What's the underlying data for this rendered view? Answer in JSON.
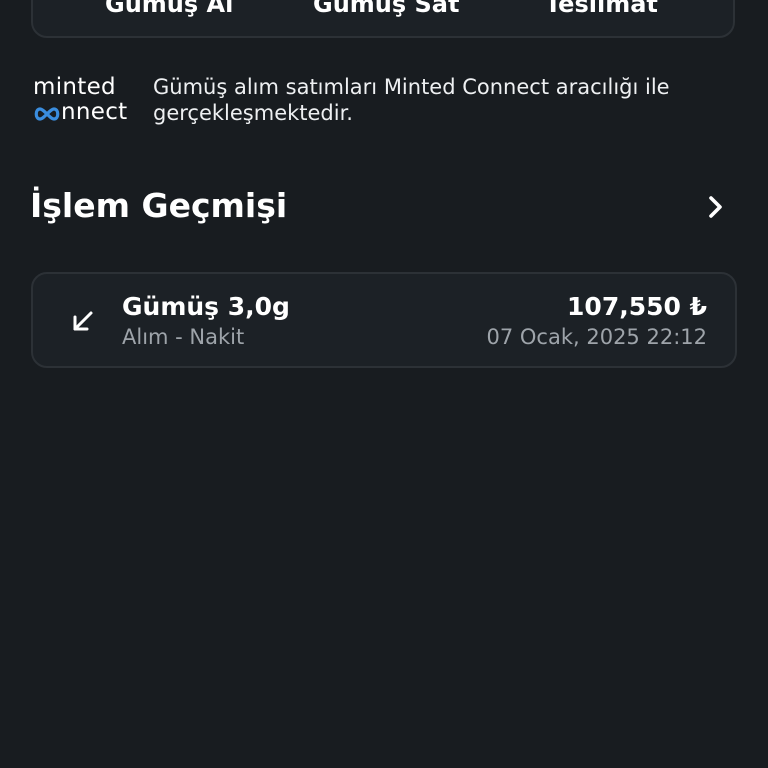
{
  "actions": {
    "buy_label": "Gümüş Al",
    "sell_label": "Gümüş Sat",
    "deliver_label": "Teslimat"
  },
  "brand": {
    "logo_line1": "minted",
    "logo_line2_suffix": "nnect",
    "logo_accent_color": "#3a8dde",
    "info_text": "Gümüş alım satımları Minted Connect aracılığı ile gerçekleşmektedir."
  },
  "history": {
    "title": "İşlem Geçmişi",
    "transactions": [
      {
        "title": "Gümüş 3,0g",
        "subtitle": "Alım - Nakit",
        "amount": "107,550 ₺",
        "date": "07 Ocak, 2025 22:12",
        "icon": "arrow-down-left-icon"
      }
    ]
  },
  "colors": {
    "background": "#181c20",
    "card_background": "#1c2126",
    "card_border": "#2c3136",
    "muted_text": "#9ea4aa"
  }
}
